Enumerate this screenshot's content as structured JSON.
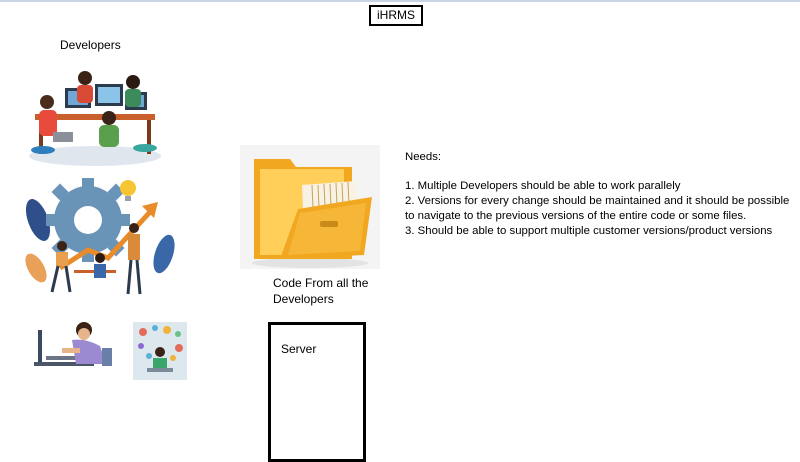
{
  "title": "iHRMS",
  "developers_label": "Developers",
  "code_label": "Code From all the Developers",
  "server_label": "Server",
  "needs": {
    "heading": "Needs:",
    "items": [
      "1. Multiple Developers should be able to work parallely",
      "2. Versions for every change should be maintained and it should be possible to navigate to the previous versions of the entire code or some files.",
      "3. Should be able to support multiple customer versions/product versions"
    ]
  },
  "colors": {
    "folder": "#f2a721",
    "folder_light": "#ffcf5a",
    "gear": "#6a93b8",
    "arrow": "#e98b2a",
    "accent_blue": "#2e5a8e"
  }
}
